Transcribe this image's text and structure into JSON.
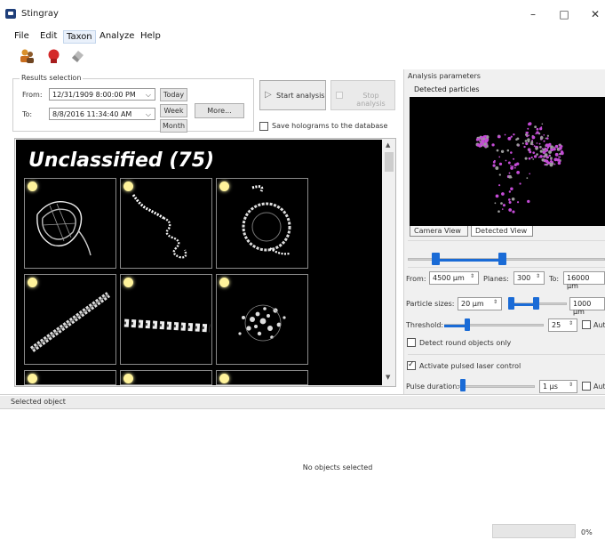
{
  "window": {
    "title": "Stingray",
    "minimize": "–",
    "maximize": "□",
    "close": "✕"
  },
  "menu": [
    "File",
    "Edit",
    "Taxon",
    "Analyze",
    "Help"
  ],
  "results_selection": {
    "title": "Results selection",
    "from_label": "From:",
    "from_value": "12/31/1909 8:00:00 PM",
    "to_label": "To:",
    "to_value": "8/8/2016 11:34:40 AM",
    "today": "Today",
    "week": "Week",
    "month": "Month",
    "more": "More..."
  },
  "actions": {
    "start": "Start analysis",
    "stop": "Stop analysis",
    "save_holograms": "Save holograms to the database",
    "save_holograms_checked": false
  },
  "viewer": {
    "heading": "Unclassified (75)"
  },
  "selected_object": {
    "header": "Selected object",
    "empty": "No objects selected",
    "progress_percent": "0%",
    "progress_value": 0
  },
  "analysis": {
    "title": "Analysis parameters",
    "detected_title": "Detected particles",
    "tab_camera": "Camera View",
    "tab_detected": "Detected View",
    "from_label": "From:",
    "from_value": "4500 µm",
    "planes_label": "Planes:",
    "planes_value": "300",
    "to_label": "To:",
    "to_value": "16000 µm",
    "sizes_label": "Particle sizes:",
    "size_min": "20 µm",
    "size_max": "1000 µm",
    "threshold_label": "Threshold:",
    "threshold_value": "25",
    "auto1": "Aut",
    "round_only": "Detect round objects only",
    "round_only_checked": false,
    "laser": "Activate pulsed laser control",
    "laser_checked": true,
    "pulse_label": "Pulse duration:",
    "pulse_value": "1 µs",
    "auto2": "Aut"
  },
  "colors": {
    "accent": "#1a6bd6",
    "particle": "#c44bd6"
  }
}
